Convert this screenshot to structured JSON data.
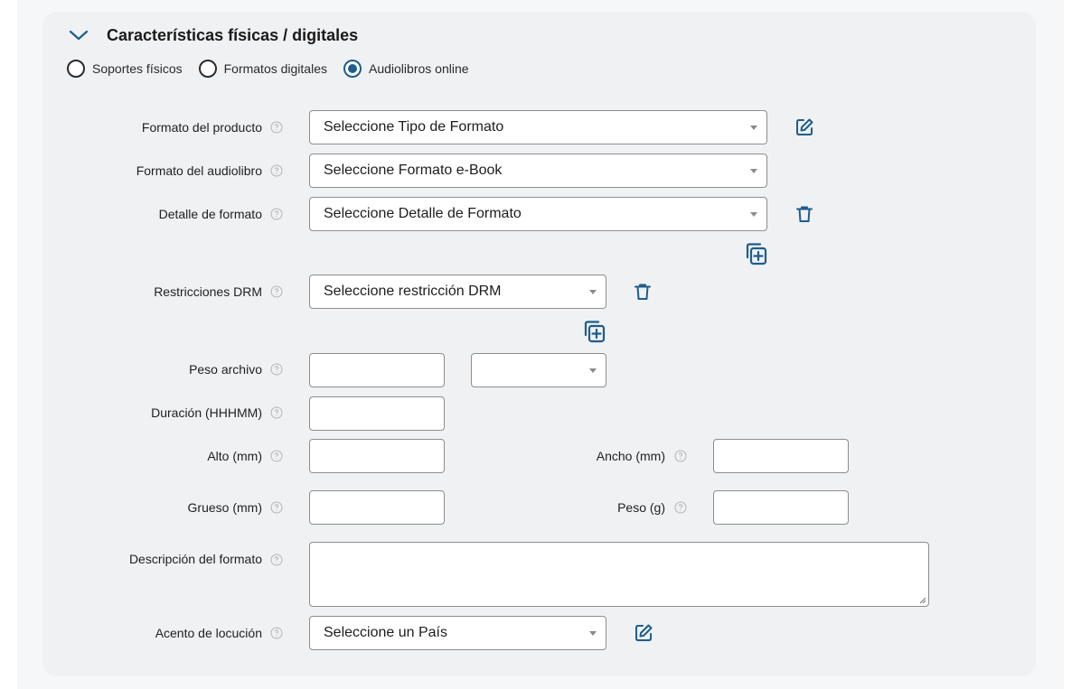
{
  "section": {
    "title": "Características físicas / digitales",
    "radios": [
      {
        "label": "Soportes físicos",
        "checked": false
      },
      {
        "label": "Formatos digitales",
        "checked": false
      },
      {
        "label": "Audiolibros online",
        "checked": true
      }
    ]
  },
  "fields": {
    "formato_producto": {
      "label": "Formato del producto",
      "value": "Seleccione Tipo de Formato"
    },
    "formato_audiolibro": {
      "label": "Formato del audiolibro",
      "value": "Seleccione Formato e-Book"
    },
    "detalle_formato": {
      "label": "Detalle de formato",
      "value": "Seleccione Detalle de Formato"
    },
    "restricciones_drm": {
      "label": "Restricciones DRM",
      "value": "Seleccione restricción DRM"
    },
    "peso_archivo": {
      "label": "Peso archivo",
      "value": "",
      "unit_value": ""
    },
    "duracion": {
      "label": "Duración (HHHMM)",
      "value": ""
    },
    "alto": {
      "label": "Alto (mm)",
      "value": ""
    },
    "ancho": {
      "label": "Ancho (mm)",
      "value": ""
    },
    "grueso": {
      "label": "Grueso (mm)",
      "value": ""
    },
    "peso": {
      "label": "Peso (g)",
      "value": ""
    },
    "descripcion_formato": {
      "label": "Descripción del formato",
      "value": ""
    },
    "acento_locucion": {
      "label": "Acento de locución",
      "value": "Seleccione un País"
    }
  },
  "icons": {
    "edit": "edit-icon",
    "delete": "trash-icon",
    "add": "add-copy-icon",
    "help": "help-circle-icon",
    "collapse": "chevron-down-icon"
  },
  "colors": {
    "accent": "#1e5d8c",
    "panel": "#eff1f3",
    "border": "#8d8d8d"
  }
}
